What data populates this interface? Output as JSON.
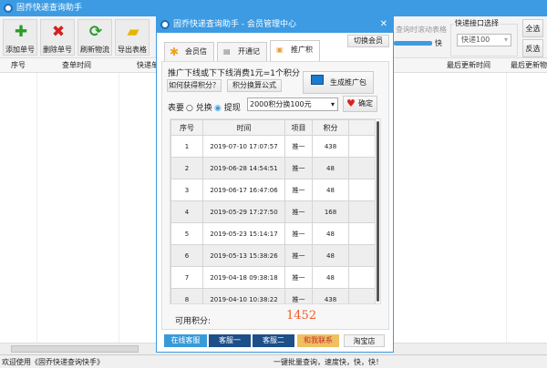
{
  "app": {
    "title": "固乔快递查询助手"
  },
  "toolbar": {
    "buttons": [
      {
        "label": "添加单号",
        "icon": "plus-icon"
      },
      {
        "label": "删除单号",
        "icon": "x-icon"
      },
      {
        "label": "刷新物流",
        "icon": "refresh-icon"
      },
      {
        "label": "导出表格",
        "icon": "folder-export-icon"
      }
    ],
    "scroll_option": "查询时滚动表格",
    "speed_label": "快",
    "speed_level": 0.95,
    "api_group_label": "快递接口选择",
    "api_selected": "快递100",
    "select_all": "全选",
    "invert_select": "反选"
  },
  "grid": {
    "columns": [
      "序号",
      "查单时间",
      "快递单",
      "最后更新时间",
      "最后更新物"
    ]
  },
  "status": {
    "left": "欢迎使用《固乔快递查询快手》",
    "right": "一键批量查询，速度快，快，快！"
  },
  "dialog": {
    "title": "固乔快递查询助手 - 会员管理中心",
    "switch_member": "切换会员",
    "tabs": [
      "会员信息",
      "开通记录",
      "推广积分"
    ],
    "active_tab": "推广积分",
    "promo_text": "推广下线或下下线消费1元=1个积分",
    "how_to_earn": "如何获得积分？",
    "formula": "积分换算公式",
    "generate_package": "生成推广包",
    "option_label": "表要",
    "radio_exchange": "兑换",
    "radio_withdraw": "提现",
    "radio_selected": "提现",
    "exchange_select": "2000积分换100元",
    "confirm": "确定",
    "table": {
      "headers": [
        "序号",
        "时间",
        "项目",
        "积分"
      ],
      "rows": [
        [
          "1",
          "2019-07-10 17:07:57",
          "推一",
          "438"
        ],
        [
          "2",
          "2019-06-28 14:54:51",
          "推一",
          "48"
        ],
        [
          "3",
          "2019-06-17 16:47:06",
          "推一",
          "48"
        ],
        [
          "4",
          "2019-05-29 17:27:50",
          "推一",
          "168"
        ],
        [
          "5",
          "2019-05-23 15:14:17",
          "推一",
          "48"
        ],
        [
          "6",
          "2019-05-13 15:38:26",
          "推一",
          "48"
        ],
        [
          "7",
          "2019-04-18 09:38:18",
          "推一",
          "48"
        ],
        [
          "8",
          "2019-04-10 10:38:22",
          "推一",
          "438"
        ]
      ]
    },
    "points_label": "可用积分:",
    "points_value": "1452",
    "footer": [
      "在线客服",
      "客服一",
      "客服二",
      "和我联系",
      "淘宝店"
    ]
  }
}
